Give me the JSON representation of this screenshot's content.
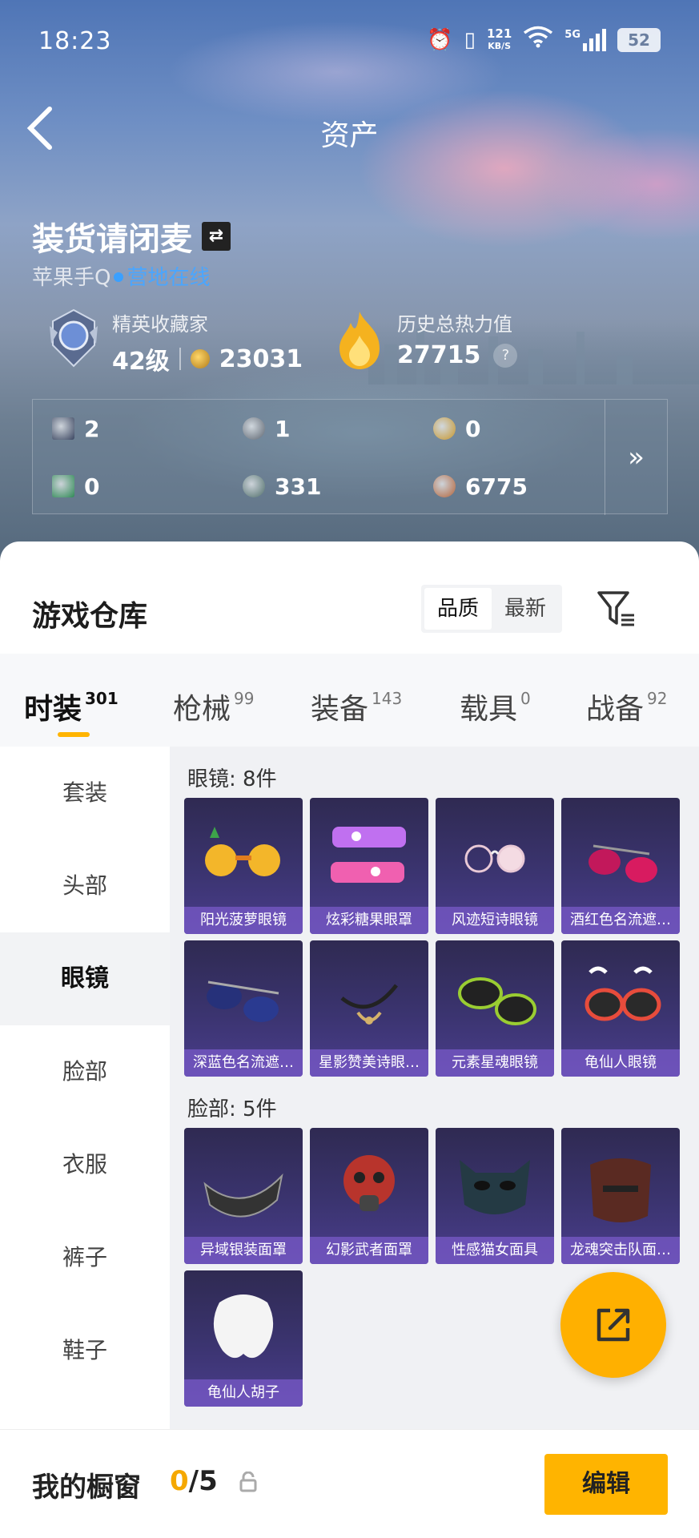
{
  "status_bar": {
    "time": "18:23",
    "net_speed": "121",
    "net_unit": "KB/S",
    "signal": "5G",
    "battery": "52"
  },
  "header": {
    "title": "资产",
    "back_icon": "chevron-left-icon"
  },
  "profile": {
    "username": "装货请闭麦",
    "platform": "苹果手Q",
    "status": "营地在线",
    "rank_title": "精英收藏家",
    "level": "42级",
    "coins": "23031",
    "heat_label": "历史总热力值",
    "heat_value": "27715",
    "help": "?"
  },
  "currencies": [
    {
      "value": "2",
      "color": "#3a4560"
    },
    {
      "value": "1",
      "color": "#5d6570"
    },
    {
      "value": "0",
      "color": "#c8962a"
    },
    {
      "value": "0",
      "color": "#2f8a55"
    },
    {
      "value": "331",
      "color": "#4f6e6a"
    },
    {
      "value": "6775",
      "color": "#b4643a"
    }
  ],
  "more_icon": "»",
  "repo": {
    "title": "游戏仓库",
    "sort_options": [
      "品质",
      "最新"
    ],
    "sort_selected": "品质"
  },
  "tabs": [
    {
      "label": "时装",
      "count": "301"
    },
    {
      "label": "枪械",
      "count": "99"
    },
    {
      "label": "装备",
      "count": "143"
    },
    {
      "label": "载具",
      "count": "0"
    },
    {
      "label": "战备",
      "count": "92"
    }
  ],
  "categories": [
    "套装",
    "头部",
    "眼镜",
    "脸部",
    "衣服",
    "裤子",
    "鞋子"
  ],
  "selected_category": "眼镜",
  "sections": [
    {
      "title": "眼镜: 8件",
      "items": [
        "阳光菠萝眼镜",
        "炫彩糖果眼罩",
        "风迹短诗眼镜",
        "酒红色名流遮…",
        "深蓝色名流遮…",
        "星影赞美诗眼…",
        "元素星魂眼镜",
        "龟仙人眼镜"
      ]
    },
    {
      "title": "脸部: 5件",
      "items": [
        "异域银装面罩",
        "幻影武者面罩",
        "性感猫女面具",
        "龙魂突击队面…",
        "龟仙人胡子"
      ]
    }
  ],
  "bottom": {
    "window_label": "我的橱窗",
    "current": "0",
    "total": "/5",
    "edit_label": "编辑"
  },
  "colors": {
    "accent": "#ffb400",
    "online": "#3aa0ff",
    "card": "#3b3470"
  }
}
